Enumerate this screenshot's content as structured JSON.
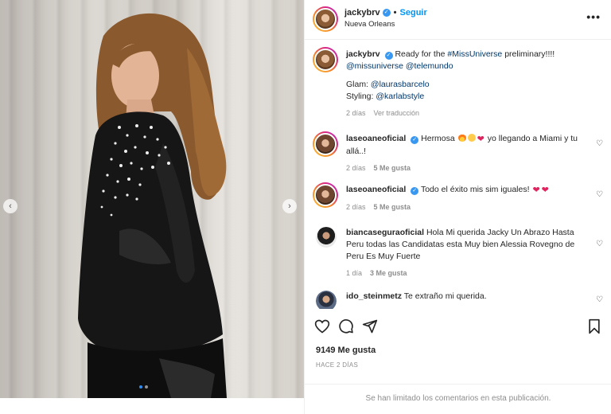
{
  "post": {
    "username": "jackybrv",
    "follow_label": "Seguir",
    "location": "Nueva Orleans",
    "more_label": "•••"
  },
  "caption": {
    "username": "jackybrv",
    "text_pre": "Ready for the ",
    "hashtag": "#MissUniverse",
    "text_post": " preliminary!!!!",
    "mention_1": "@missuniverse",
    "mention_2": "@telemundo",
    "glam_label": "Glam: ",
    "glam_mention": "@laurasbarcelo",
    "styling_label": "Styling: ",
    "styling_mention": "@karlabstyle",
    "time": "2 días",
    "translate": "Ver traducción"
  },
  "comments": [
    {
      "username": "laseoaneoficial",
      "text_pre": "Hermosa ",
      "text_post": " yo llegando a Miami y tu allá..!",
      "time": "2 días",
      "likes": "5 Me gusta"
    },
    {
      "username": "laseoaneoficial",
      "text": "Todo el éxito mis sim iguales! ",
      "time": "2 días",
      "likes": "5 Me gusta"
    },
    {
      "username": "biancaseguraoficial",
      "text": "Hola Mi querida Jacky Un Abrazo Hasta Peru todas las Candidatas esta Muy bien Alessia Rovegno de Peru Es Muy Fuerte",
      "time": "1 día",
      "likes": "3 Me gusta"
    },
    {
      "username": "ido_steinmetz",
      "text": "Te extraño mi querida."
    }
  ],
  "stats": {
    "likes": "9149 Me gusta",
    "time_ago": "HACE 2 DÍAS"
  },
  "footer": {
    "notice": "Se han limitado los comentarios en esta publicación."
  },
  "carousel": {
    "current_index": 1,
    "total": 2
  },
  "icons": [
    "more-icon",
    "verified-icon",
    "heart-icon",
    "comment-icon",
    "share-icon",
    "bookmark-icon",
    "chevron-left-icon",
    "chevron-right-icon"
  ],
  "colors": {
    "accent": "#0095f6",
    "verified": "#3897f0",
    "mention": "#00376b",
    "muted": "#8e8e8e",
    "heart": "#e0245e"
  }
}
